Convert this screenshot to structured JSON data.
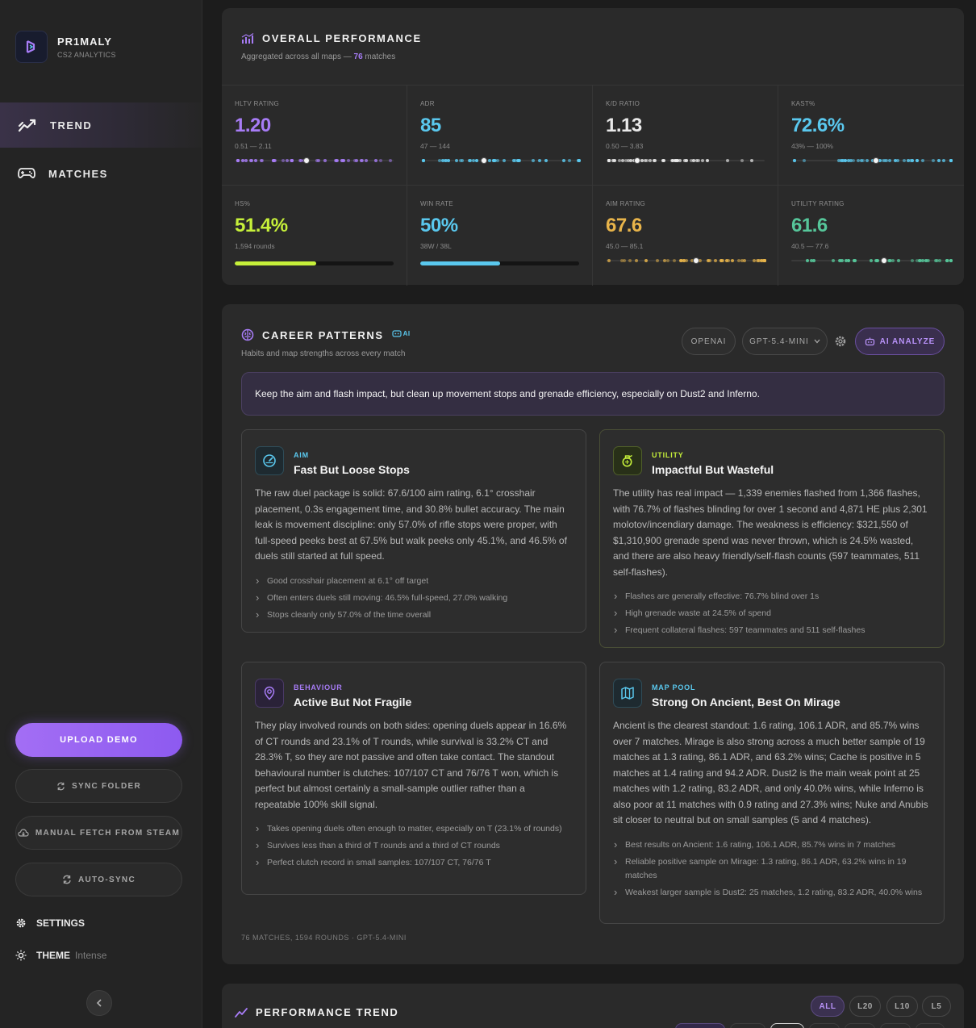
{
  "brand": {
    "name": "PR1MALY",
    "subtitle": "CS2 ANALYTICS"
  },
  "nav": {
    "trend": "TREND",
    "matches": "MATCHES"
  },
  "sidebar": {
    "upload": "UPLOAD DEMO",
    "sync_folder": "SYNC FOLDER",
    "manual_fetch": "MANUAL FETCH FROM STEAM",
    "auto_sync": "AUTO-SYNC",
    "settings": "SETTINGS",
    "theme_label": "THEME",
    "theme_value": "Intense"
  },
  "overall": {
    "title": "OVERALL PERFORMANCE",
    "subtitle_prefix": "Aggregated across all maps —",
    "match_count": "76",
    "subtitle_suffix": "matches",
    "stats": [
      {
        "label": "HLTV RATING",
        "value": "1.20",
        "range": "0.51 — 2.11",
        "color": "#a77cf6",
        "kind": "strip",
        "marker": 0.44
      },
      {
        "label": "ADR",
        "value": "85",
        "range": "47 — 144",
        "color": "#5ac8ee",
        "kind": "strip",
        "marker": 0.39
      },
      {
        "label": "K/D RATIO",
        "value": "1.13",
        "range": "0.50 — 3.83",
        "color": "#e9e9e9",
        "kind": "strip",
        "marker": 0.19
      },
      {
        "label": "KAST%",
        "value": "72.6%",
        "range": "43% — 100%",
        "color": "#5ac8ee",
        "kind": "strip",
        "marker": 0.52
      },
      {
        "label": "HS%",
        "value": "51.4%",
        "range": "1,594 rounds",
        "color": "#c6f03a",
        "kind": "bar",
        "fill": 0.514
      },
      {
        "label": "WIN RATE",
        "value": "50%",
        "range": "38W / 38L",
        "color": "#5ac8ee",
        "kind": "bar",
        "fill": 0.5
      },
      {
        "label": "AIM RATING",
        "value": "67.6",
        "range": "45.0 — 85.1",
        "color": "#e8b44a",
        "kind": "strip",
        "marker": 0.56
      },
      {
        "label": "UTILITY RATING",
        "value": "61.6",
        "range": "40.5 — 77.6",
        "color": "#56c69a",
        "kind": "strip",
        "marker": 0.57
      }
    ]
  },
  "career": {
    "title": "CAREER PATTERNS",
    "ai_badge": "AI",
    "subtitle": "Habits and map strengths across every match",
    "provider": "OPENAI",
    "model": "GPT-5.4-MINI",
    "analyze": "AI ANALYZE",
    "summary": "Keep the aim and flash impact, but clean up movement stops and grenade efficiency, especially on Dust2 and Inferno.",
    "cards": [
      {
        "category": "AIM",
        "title": "Fast But Loose Stops",
        "color": "#5ac8ee",
        "body": "The raw duel package is solid: 67.6/100 aim rating, 6.1° crosshair placement, 0.3s engagement time, and 30.8% bullet accuracy. The main leak is movement discipline: only 57.0% of rifle stops were proper, with full-speed peeks best at 67.5% but walk peeks only 45.1%, and 46.5% of duels still started at full speed.",
        "points": [
          "Good crosshair placement at 6.1° off target",
          "Often enters duels still moving: 46.5% full-speed, 27.0% walking",
          "Stops cleanly only 57.0% of the time overall"
        ]
      },
      {
        "category": "UTILITY",
        "title": "Impactful But Wasteful",
        "color": "#c6f03a",
        "body": "The utility has real impact — 1,339 enemies flashed from 1,366 flashes, with 76.7% of flashes blinding for over 1 second and 4,871 HE plus 2,301 molotov/incendiary damage. The weakness is efficiency: $321,550 of $1,310,900 grenade spend was never thrown, which is 24.5% wasted, and there are also heavy friendly/self-flash counts (597 teammates, 511 self-flashes).",
        "points": [
          "Flashes are generally effective: 76.7% blind over 1s",
          "High grenade waste at 24.5% of spend",
          "Frequent collateral flashes: 597 teammates and 511 self-flashes"
        ]
      },
      {
        "category": "BEHAVIOUR",
        "title": "Active But Not Fragile",
        "color": "#a77cf6",
        "body": "They play involved rounds on both sides: opening duels appear in 16.6% of CT rounds and 23.1% of T rounds, while survival is 33.2% CT and 28.3% T, so they are not passive and often take contact. The standout behavioural number is clutches: 107/107 CT and 76/76 T won, which is perfect but almost certainly a small-sample outlier rather than a repeatable 100% skill signal.",
        "points": [
          "Takes opening duels often enough to matter, especially on T (23.1% of rounds)",
          "Survives less than a third of T rounds and a third of CT rounds",
          "Perfect clutch record in small samples: 107/107 CT, 76/76 T"
        ]
      },
      {
        "category": "MAP POOL",
        "title": "Strong On Ancient, Best On Mirage",
        "color": "#5ac8ee",
        "body": "Ancient is the clearest standout: 1.6 rating, 106.1 ADR, and 85.7% wins over 7 matches. Mirage is also strong across a much better sample of 19 matches at 1.3 rating, 86.1 ADR, and 63.2% wins; Cache is positive in 5 matches at 1.4 rating and 94.2 ADR. Dust2 is the main weak point at 25 matches with 1.2 rating, 83.2 ADR, and only 40.0% wins, while Inferno is also poor at 11 matches with 0.9 rating and 27.3% wins; Nuke and Anubis sit closer to neutral but on small samples (5 and 4 matches).",
        "points": [
          "Best results on Ancient: 1.6 rating, 106.1 ADR, 85.7% wins in 7 matches",
          "Reliable positive sample on Mirage: 1.3 rating, 86.1 ADR, 63.2% wins in 19 matches",
          "Weakest larger sample is Dust2: 25 matches, 1.2 rating, 83.2 ADR, 40.0% wins"
        ]
      }
    ],
    "footnote": "76 MATCHES, 1594 ROUNDS · GPT-5.4-MINI"
  },
  "trend": {
    "title": "PERFORMANCE TREND",
    "ranges": [
      "ALL",
      "L20",
      "L10",
      "L5"
    ],
    "selected": "ALL"
  }
}
